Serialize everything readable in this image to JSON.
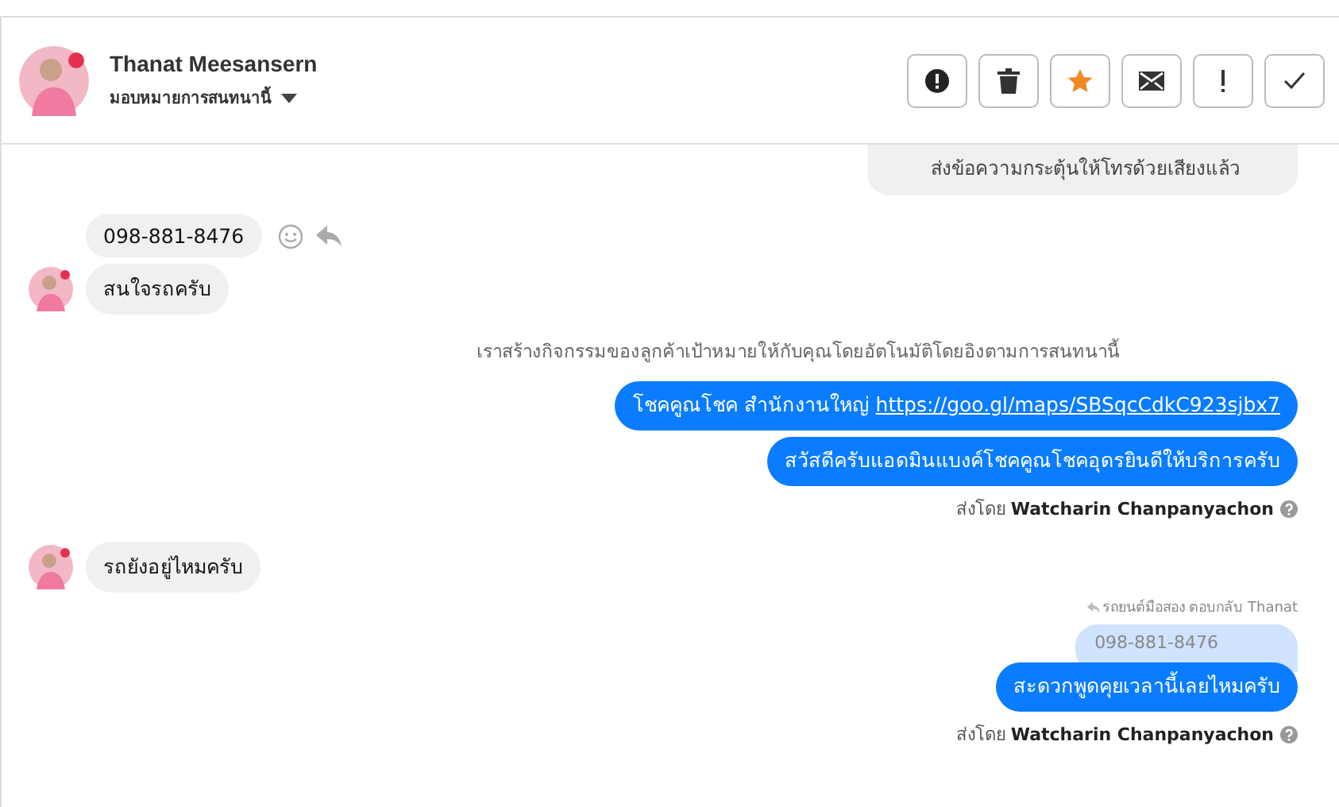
{
  "header": {
    "name": "Thanat Meesansern",
    "assign": "มอบหมายการสนทนานี้"
  },
  "actions": [
    {
      "kind": "alert",
      "active": false
    },
    {
      "kind": "trash",
      "active": false
    },
    {
      "kind": "star",
      "active": true
    },
    {
      "kind": "mail",
      "active": false
    },
    {
      "kind": "exclaim",
      "active": false
    },
    {
      "kind": "check",
      "active": false
    }
  ],
  "messages": [
    {
      "kind": "notice",
      "text": "ส่งข้อความกระตุ้นให้โทรด้วยเสียงแล้ว"
    },
    {
      "kind": "incoming",
      "bubbles": [
        "098-881-8476",
        "สนใจรถครับ"
      ]
    },
    {
      "kind": "system",
      "text": "เราสร้างกิจกรรมของลูกค้าเป้าหมายให้กับคุณโดยอัตโนมัติโดยอิงตามการสนทนานี้"
    },
    {
      "kind": "outgoing",
      "bubbles": [
        {
          "text": "โชคคูณโชค สำนักงานใหญ่",
          "link": "https://goo.gl/maps/SBSqcCdkC923sjbx7"
        },
        {
          "text": "สวัสดีครับแอดมินแบงค์โชคคูณโชคอุดรยินดีให้บริการครับ"
        }
      ],
      "sender": "ส่งโดย **Watcharin Chanpanyachon**"
    },
    {
      "kind": "incoming",
      "bubbles": [
        "รถยังอยู่ไหมครับ"
      ]
    },
    {
      "kind": "reply",
      "label": "รถยนต์มือสอง ตอบกลับ Thanat",
      "quote": "098-881-8476",
      "bubbles": [
        {
          "text": "สะดวกพูดคุยเวลานี้เลยไหมครับ"
        }
      ],
      "sender": "ส่งโดย **Watcharin Chanpanyachon**"
    }
  ]
}
